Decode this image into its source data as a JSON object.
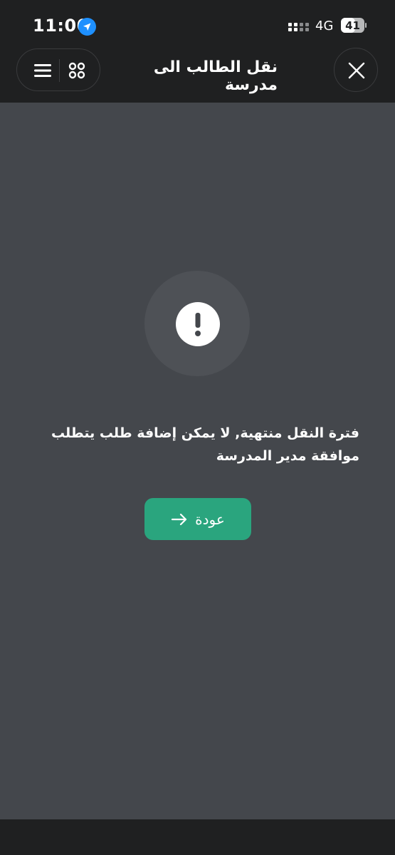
{
  "status_bar": {
    "time": "11:00",
    "network": "4G",
    "battery": "41",
    "icons": [
      "location-arrow-icon",
      "signal-dots-icon",
      "battery-icon"
    ]
  },
  "header": {
    "title": "نقل الطالب الى مدرسة",
    "icons": [
      "hamburger-menu-icon",
      "apps-grid-icon",
      "close-x-icon"
    ]
  },
  "main": {
    "alert_icon": "exclamation-icon",
    "message": "فترة النقل منتهية, لا يمكن إضافة طلب يتطلب موافقة مدير المدرسة",
    "back_button": {
      "label": "عودة",
      "icon": "arrow-right-icon"
    }
  },
  "colors": {
    "background_dark": "#1f2021",
    "content_background": "#44474c",
    "alert_halo": "#4e5156",
    "accent_green": "#2aa57e",
    "location_blue": "#1e90ff",
    "text": "#ffffff"
  }
}
